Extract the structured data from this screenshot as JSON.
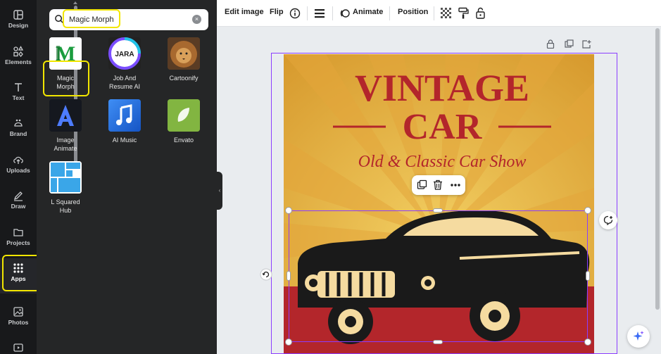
{
  "rail": {
    "items": [
      {
        "label": "Design"
      },
      {
        "label": "Elements"
      },
      {
        "label": "Text"
      },
      {
        "label": "Brand"
      },
      {
        "label": "Uploads"
      },
      {
        "label": "Draw"
      },
      {
        "label": "Projects"
      },
      {
        "label": "Apps"
      },
      {
        "label": "Photos"
      }
    ]
  },
  "search": {
    "value": "Magic Morph"
  },
  "apps": [
    {
      "name_line1": "Magic",
      "name_line2": "Morph",
      "icon": "magic-morph-icon"
    },
    {
      "name_line1": "Job And",
      "name_line2": "Resume AI",
      "icon": "jara-icon",
      "badge": "JARA"
    },
    {
      "name_line1": "Cartoonify",
      "name_line2": "",
      "icon": "lion-icon"
    },
    {
      "name_line1": "Image",
      "name_line2": "Animate",
      "icon": "image-animate-icon"
    },
    {
      "name_line1": "AI Music",
      "name_line2": "",
      "icon": "music-note-icon"
    },
    {
      "name_line1": "Envato",
      "name_line2": "",
      "icon": "envato-leaf-icon"
    },
    {
      "name_line1": "L Squared",
      "name_line2": "Hub",
      "icon": "l-squared-icon"
    }
  ],
  "toolbar": {
    "edit_image": "Edit image",
    "flip": "Flip",
    "animate": "Animate",
    "position": "Position"
  },
  "poster": {
    "title_line1": "VINTAGE",
    "title_line2": "CAR",
    "subtitle": "Old & Classic Car Show"
  },
  "colors": {
    "accent": "#8b3dff",
    "highlight": "#f2e600",
    "poster_red": "#b3262b",
    "poster_yellow": "#e8b83a"
  }
}
